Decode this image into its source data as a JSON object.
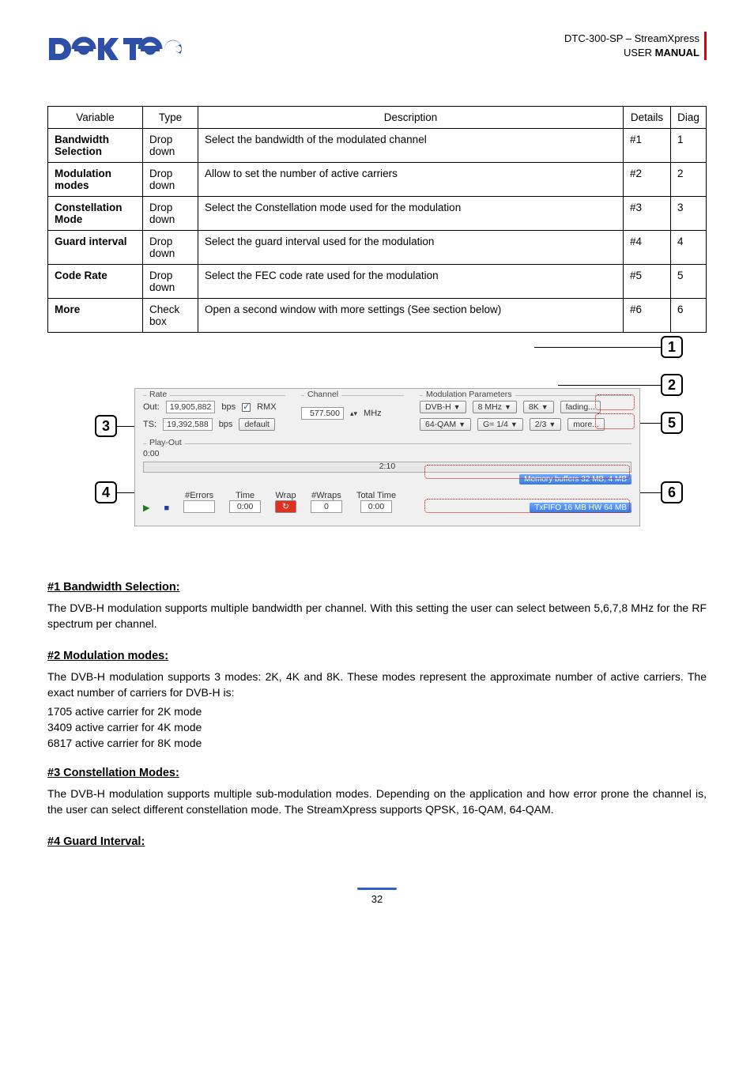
{
  "header": {
    "product": "DTC-300-SP – StreamXpress",
    "doc": "USER MANUAL",
    "manual_bold": "MANUAL",
    "logo_text": "DekTec"
  },
  "table": {
    "headers": {
      "variable": "Variable",
      "type": "Type",
      "description": "Description",
      "details": "Details",
      "diag": "Diag"
    },
    "rows": [
      {
        "variable": "Bandwidth Selection",
        "type": "Drop down",
        "description": "Select the bandwidth of the modulated channel",
        "details": "#1",
        "diag": "1"
      },
      {
        "variable": "Modulation modes",
        "type": "Drop down",
        "description": "Allow to set the number of active carriers",
        "details": "#2",
        "diag": "2"
      },
      {
        "variable": "Constellation Mode",
        "type": "Drop down",
        "description": "Select the Constellation mode used for the modulation",
        "details": "#3",
        "diag": "3"
      },
      {
        "variable": "Guard interval",
        "type": "Drop down",
        "description": "Select the guard interval used for the modulation",
        "details": "#4",
        "diag": "4"
      },
      {
        "variable": "Code Rate",
        "type": "Drop down",
        "description": "Select the FEC code rate used for the modulation",
        "details": "#5",
        "diag": "5"
      },
      {
        "variable": "More",
        "type": "Check box",
        "description": "Open a second window with more settings (See section below)",
        "details": "#6",
        "diag": "6"
      }
    ]
  },
  "panel": {
    "rate_label": "Rate",
    "out_label": "Out:",
    "out_value": "19,905,882",
    "bps": "bps",
    "rmx_label": "RMX",
    "ts_label": "TS:",
    "ts_value": "19,392,588",
    "default_btn": "default",
    "channel_label": "Channel",
    "channel_value": "577.500",
    "mhz": "MHz",
    "mod_params_label": "Modulation Parameters",
    "dvbh": "DVB-H",
    "bw": "8 MHz",
    "mode": "8K",
    "fading": "fading...",
    "constellation": "64-QAM",
    "guard": "G= 1/4",
    "coderate": "2/3",
    "more_btn": "more...",
    "playout_label": "Play-Out",
    "playout_time": "0:00",
    "progress_time": "2:10",
    "mem_status": "Memory buffers 32 MB, 4 MB",
    "errors_label": "#Errors",
    "time_label": "Time",
    "time_value": "0:00",
    "wrap_label": "Wrap",
    "wraps_label": "#Wraps",
    "wraps_value": "0",
    "total_time_label": "Total Time",
    "total_time_value": "0:00",
    "fifo_status": "TxFIFO 16 MB   HW 64 MB"
  },
  "callouts": {
    "c1": "1",
    "c2": "2",
    "c3": "3",
    "c4": "4",
    "c5": "5",
    "c6": "6"
  },
  "sections": {
    "s1": {
      "title": "#1 Bandwidth Selection:",
      "p1": "The DVB-H modulation supports multiple bandwidth per channel. With this setting the user can select between 5,6,7,8 MHz for the RF spectrum per channel."
    },
    "s2": {
      "title": "#2 Modulation modes:",
      "p1": "The DVB-H modulation supports 3 modes: 2K, 4K and 8K. These modes represent the approximate number of active carriers. The exact number of carriers for DVB-H is:",
      "l1": "1705 active carrier for 2K mode",
      "l2": "3409 active carrier for 4K mode",
      "l3": "6817 active carrier for 8K mode"
    },
    "s3": {
      "title": "#3 Constellation Modes:",
      "p1": "The DVB-H modulation supports multiple sub-modulation modes. Depending on the application and how error prone the channel is, the user can select different constellation mode. The StreamXpress supports QPSK, 16-QAM, 64-QAM."
    },
    "s4": {
      "title": "#4 Guard Interval:"
    }
  },
  "page_number": "32"
}
